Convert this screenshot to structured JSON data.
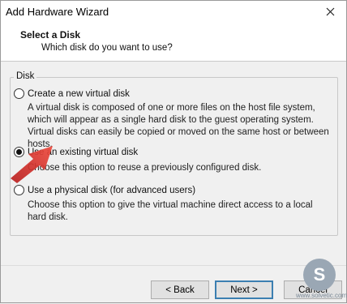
{
  "window": {
    "title": "Add Hardware Wizard"
  },
  "header": {
    "title": "Select a Disk",
    "subtitle": "Which disk do you want to use?"
  },
  "group": {
    "label": "Disk"
  },
  "options": [
    {
      "label": "Create a new virtual disk",
      "description": "A virtual disk is composed of one or more files on the host file system, which will appear as a single hard disk to the guest operating system. Virtual disks can easily be copied or moved on the same host or between hosts.",
      "selected": false
    },
    {
      "label": "Use an existing virtual disk",
      "description": "Choose this option to reuse a previously configured disk.",
      "selected": true
    },
    {
      "label": "Use a physical disk (for advanced users)",
      "description": "Choose this option to give the virtual machine direct access to a local hard disk.",
      "selected": false
    }
  ],
  "buttons": {
    "back": "< Back",
    "next": "Next >",
    "cancel": "Cancel"
  },
  "colors": {
    "arrow": "#e0332d",
    "accent": "#3c7fb1"
  },
  "watermark": {
    "letter": "S",
    "text": "www.solvetic.com"
  }
}
